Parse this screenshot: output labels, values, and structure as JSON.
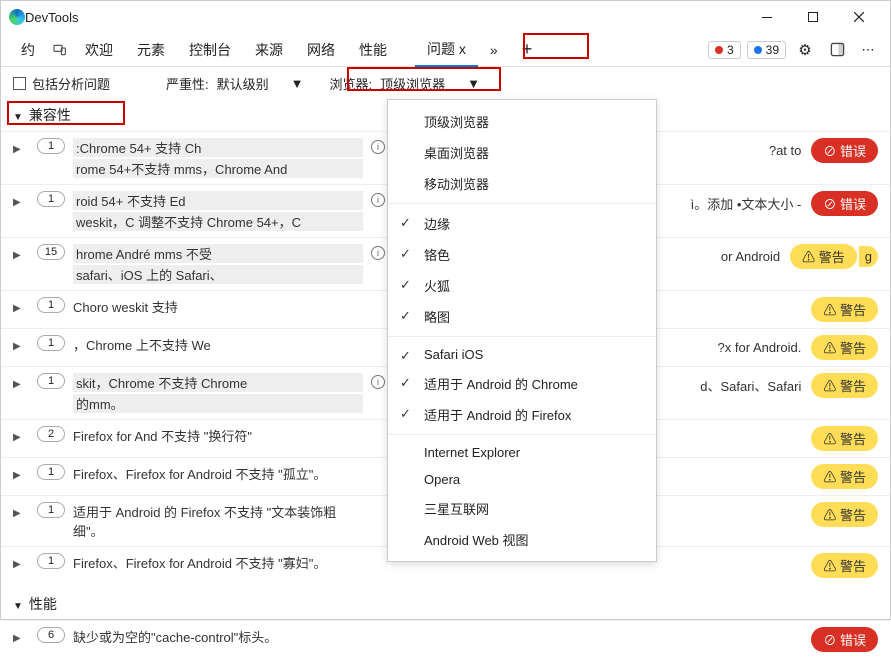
{
  "window": {
    "title": "DevTools"
  },
  "tabs": {
    "left_label": "约",
    "items": [
      "欢迎",
      "元素",
      "控制台",
      "来源",
      "网络",
      "性能"
    ],
    "issues_label": "问题 x",
    "more_label": "»",
    "plus_label": "+"
  },
  "counters": {
    "errors": "3",
    "info": "39"
  },
  "filter": {
    "include_label": "包括分析问题",
    "severity_label": "严重性:",
    "severity_value": "默认级别",
    "browser_label": "浏览器:",
    "browser_value": "顶级浏览器"
  },
  "sections": {
    "compat": "兼容性",
    "perf": "性能"
  },
  "menu": {
    "items": [
      {
        "label": "顶级浏览器",
        "checked": false
      },
      {
        "label": "桌面浏览器",
        "checked": false
      },
      {
        "label": "移动浏览器",
        "checked": false
      },
      {
        "sep": true
      },
      {
        "label": "边缘",
        "checked": true
      },
      {
        "label": "铬色",
        "checked": true
      },
      {
        "label": "火狐",
        "checked": true
      },
      {
        "label": "略图",
        "checked": true
      },
      {
        "sep": true
      },
      {
        "label": "Safari iOS",
        "checked": true
      },
      {
        "label": "适用于 Android 的 Chrome",
        "checked": true
      },
      {
        "label": "适用于 Android 的 Firefox",
        "checked": true
      },
      {
        "sep": true
      },
      {
        "label": "Internet Explorer",
        "checked": false
      },
      {
        "label": "Opera",
        "checked": false
      },
      {
        "label": "三星互联网",
        "checked": false
      },
      {
        "label": "Android Web 视图",
        "checked": false
      }
    ]
  },
  "issues": [
    {
      "count": "1",
      "a": ":Chrome 54+ 支持 Ch",
      "b": "rome 54+不支持 mms，Chrome And",
      "rt": "?at to",
      "sev": "error",
      "sev_label": "错误",
      "info": true
    },
    {
      "count": "1",
      "a": "roid 54+ 不支持   Ed",
      "b": "weskit，C 调整不支持 Chrome 54+，C",
      "rt": "ì。添加 •文本大小 -",
      "sev": "error",
      "sev_label": "错误",
      "info": true
    },
    {
      "count": "15",
      "a": "hrome André mms 不受",
      "b": "safari、iOS 上的  Safari、",
      "rt": "or  Android",
      "sev": "warn",
      "sev_label": "警告",
      "info": true,
      "g": "g"
    },
    {
      "count": "1",
      "text": "Choro weskit 支持",
      "sev": "warn",
      "sev_label": "警告"
    },
    {
      "count": "1",
      "text": "，Chrome 上不支持 We",
      "rt": "?x for Android.",
      "sev": "warn",
      "sev_label": "警告"
    },
    {
      "count": "1",
      "a": "skit，Chrome 不支持 Chrome",
      "b": "的mm。",
      "rt": "d、Safari、Safari",
      "sev": "warn",
      "sev_label": "警告",
      "info": true
    },
    {
      "count": "2",
      "text": "Firefox for And 不支持 \"换行符\"",
      "sev": "warn",
      "sev_label": "警告"
    },
    {
      "count": "1",
      "text": "Firefox、Firefox for Android 不支持 \"孤立\"。",
      "sev": "warn",
      "sev_label": "警告"
    },
    {
      "count": "1",
      "text": "适用于 Android 的 Firefox 不支持 \"文本装饰粗细\"。",
      "sev": "warn",
      "sev_label": "警告"
    },
    {
      "count": "1",
      "text": "Firefox、Firefox for Android 不支持 \"寡妇\"。",
      "sev": "warn",
      "sev_label": "警告"
    }
  ],
  "perf_issue": {
    "count": "6",
    "text": "缺少或为空的\"cache-control\"标头。",
    "sev": "error",
    "sev_label": "错误"
  }
}
